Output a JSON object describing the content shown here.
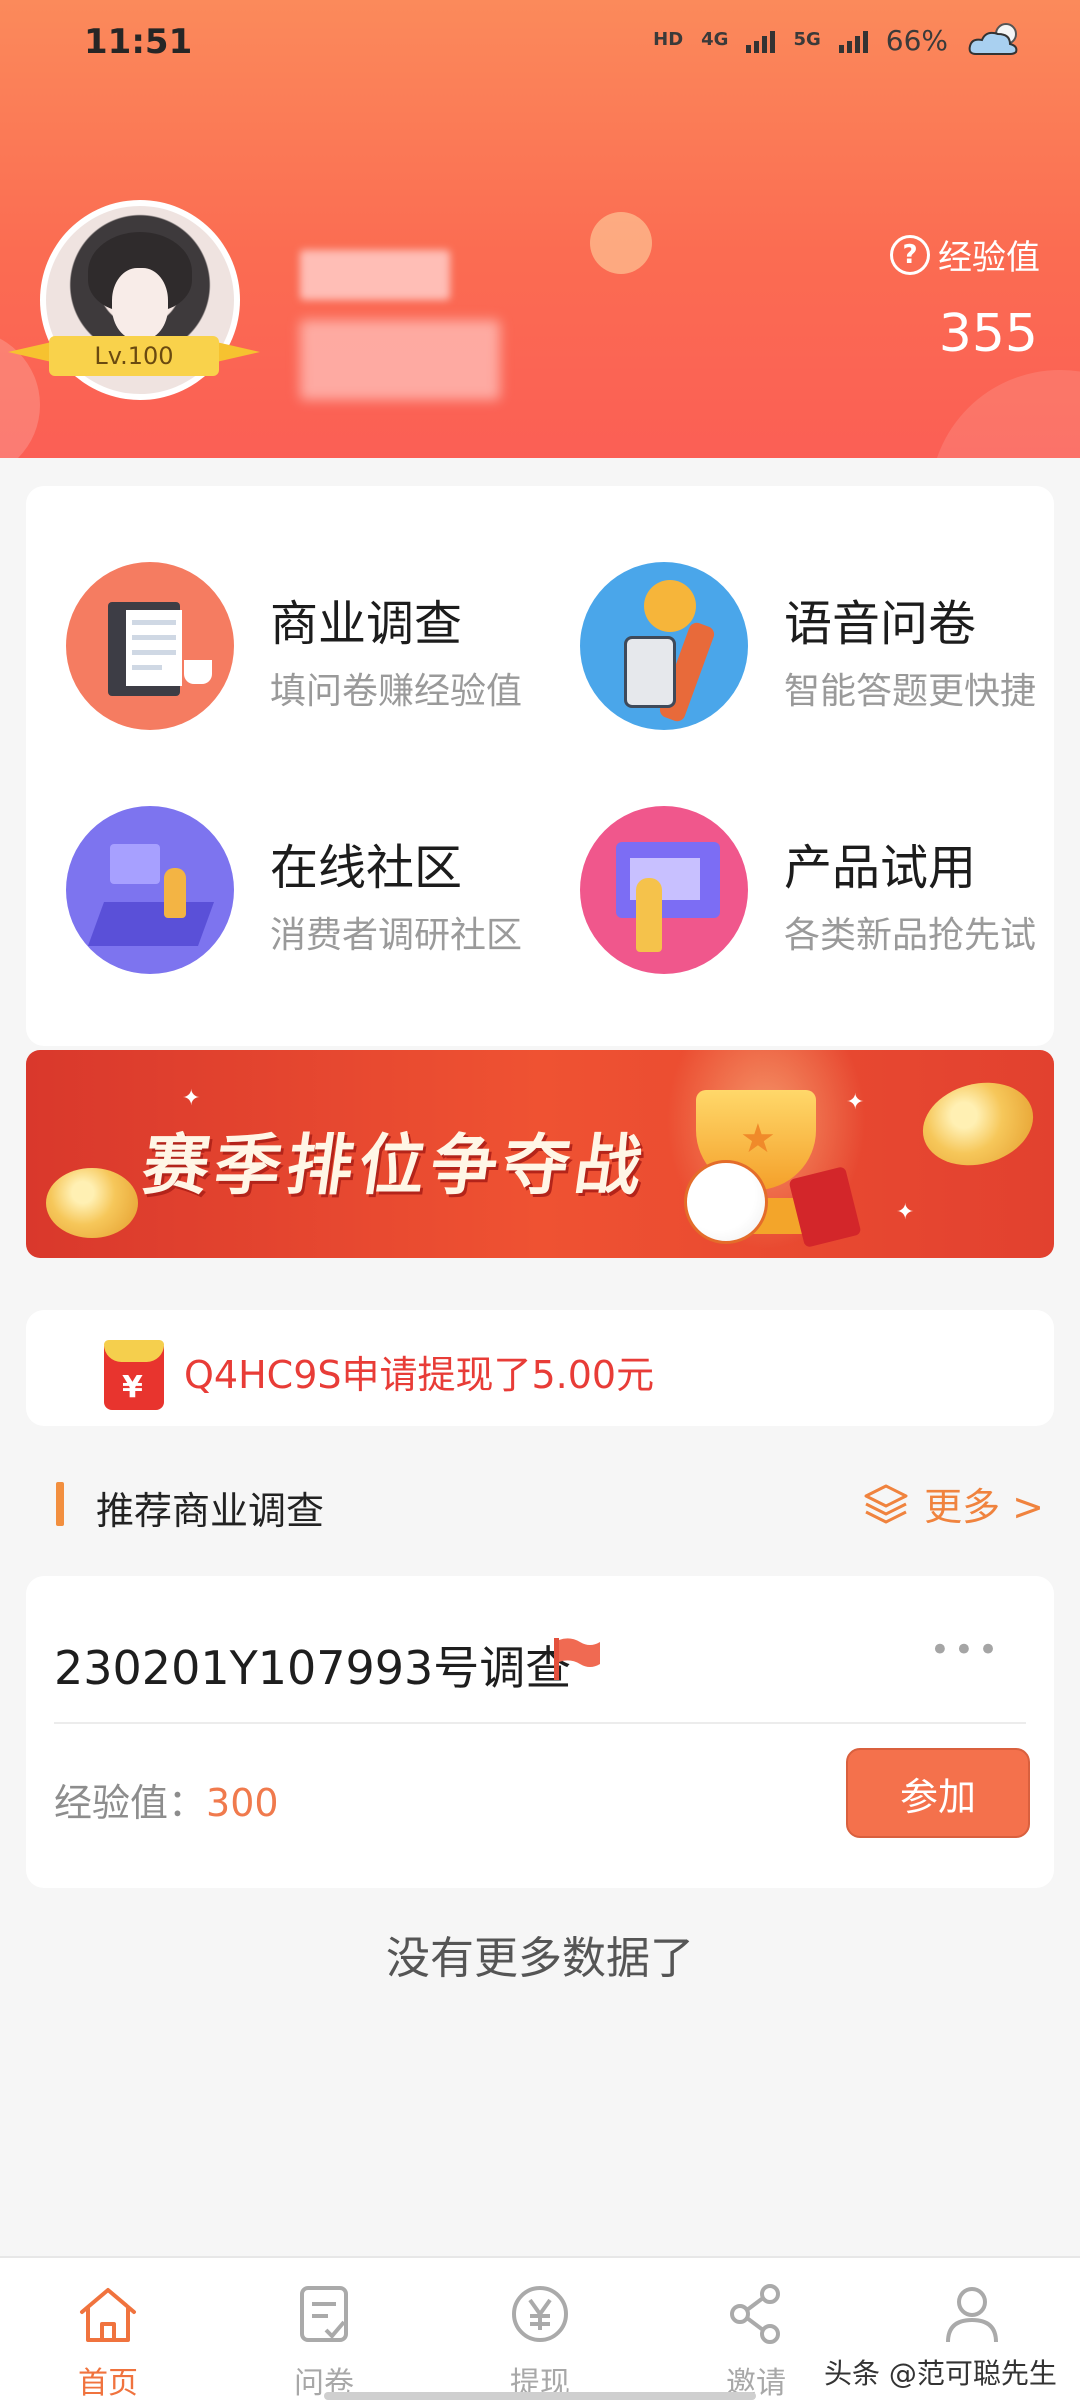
{
  "status_bar": {
    "time": "11:51",
    "hd": "HD",
    "network_1": "4G",
    "network_2": "5G",
    "battery": "66%",
    "weather_icon": "cloud-weather-icon"
  },
  "profile": {
    "level": "Lv.100",
    "exp_label": "经验值",
    "exp_value": "355"
  },
  "categories": [
    {
      "title": "商业调查",
      "subtitle": "填问卷赚经验值",
      "icon": "business-survey-icon"
    },
    {
      "title": "语音问卷",
      "subtitle": "智能答题更快捷",
      "icon": "voice-questionnaire-icon"
    },
    {
      "title": "在线社区",
      "subtitle": "消费者调研社区",
      "icon": "online-community-icon"
    },
    {
      "title": "产品试用",
      "subtitle": "各类新品抢先试",
      "icon": "product-trial-icon"
    }
  ],
  "banner": {
    "title": "赛季排位争夺战"
  },
  "notice": {
    "text": "Q4HC9S申请提现了5.00元",
    "icon": "red-packet-icon"
  },
  "section": {
    "title": "推荐商业调查",
    "more": "更多 >"
  },
  "survey": {
    "name": "230201Y107993号调查",
    "more_dots": "•••",
    "exp_label": "经验值：",
    "exp_value": "300",
    "join_label": "参加"
  },
  "footer_text": "没有更多数据了",
  "tabs": [
    {
      "label": "首页",
      "active": true
    },
    {
      "label": "问卷",
      "active": false
    },
    {
      "label": "提现",
      "active": false
    },
    {
      "label": "邀请",
      "active": false
    },
    {
      "label": "我的",
      "active": false
    }
  ],
  "watermark": "头条 @范可聪先生",
  "colors": {
    "header": "#fb6c52",
    "accent": "#f0733e",
    "notice_text": "#e83c37",
    "join_button": "#f4714c"
  }
}
